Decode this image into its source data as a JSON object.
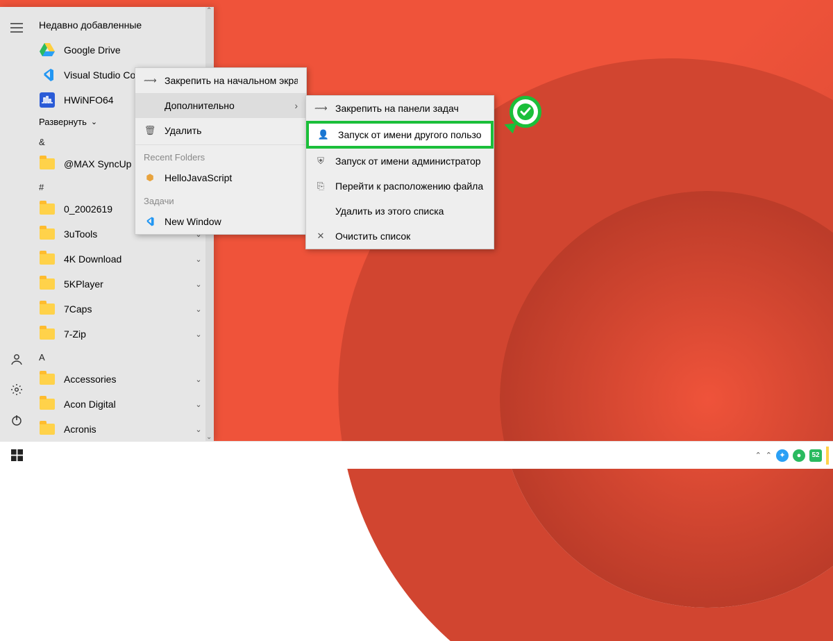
{
  "start_menu": {
    "recently_added_header": "Недавно добавленные",
    "recently_added": [
      {
        "icon": "gdrive",
        "label": "Google Drive"
      },
      {
        "icon": "vscode",
        "label": "Visual Studio Cod"
      },
      {
        "icon": "hwinfo",
        "label": "HWiNFO64"
      }
    ],
    "expand_label": "Развернуть",
    "groups": [
      {
        "letter": "&",
        "items": [
          {
            "icon": "folder",
            "label": "@MAX SyncUp",
            "chevron": true
          }
        ]
      },
      {
        "letter": "#",
        "items": [
          {
            "icon": "folder",
            "label": "0_2002619",
            "chevron": true
          },
          {
            "icon": "folder",
            "label": "3uTools",
            "chevron": true
          },
          {
            "icon": "folder",
            "label": "4K Download",
            "chevron": true
          },
          {
            "icon": "folder",
            "label": "5KPlayer",
            "chevron": true
          },
          {
            "icon": "folder",
            "label": "7Caps",
            "chevron": true
          },
          {
            "icon": "folder",
            "label": "7-Zip",
            "chevron": true
          }
        ]
      },
      {
        "letter": "A",
        "items": [
          {
            "icon": "folder",
            "label": "Accessories",
            "chevron": true
          },
          {
            "icon": "folder",
            "label": "Acon Digital",
            "chevron": true
          },
          {
            "icon": "folder",
            "label": "Acronis",
            "chevron": true
          }
        ]
      }
    ]
  },
  "context_menu_1": {
    "items": [
      {
        "icon": "pin",
        "label": "Закрепить на начальном экране"
      },
      {
        "icon": "",
        "label": "Дополнительно",
        "arrow": true,
        "hover": true
      },
      {
        "icon": "trash",
        "label": "Удалить"
      }
    ],
    "section_recent": "Recent Folders",
    "recent_items": [
      {
        "icon": "js",
        "label": "HelloJavaScript"
      }
    ],
    "section_tasks": "Задачи",
    "task_items": [
      {
        "icon": "vscode",
        "label": "New Window"
      }
    ]
  },
  "context_menu_2": {
    "items": [
      {
        "icon": "pin",
        "label": "Закрепить на панели задач"
      },
      {
        "icon": "user",
        "label": "Запуск от имени другого пользо",
        "highlight": true
      },
      {
        "icon": "admin",
        "label": "Запуск от имени администратор"
      },
      {
        "icon": "file",
        "label": "Перейти к расположению файла"
      },
      {
        "icon": "",
        "label": "Удалить из этого списка"
      },
      {
        "icon": "x",
        "label": "Очистить список"
      }
    ]
  },
  "tray": {
    "badge": "52"
  }
}
